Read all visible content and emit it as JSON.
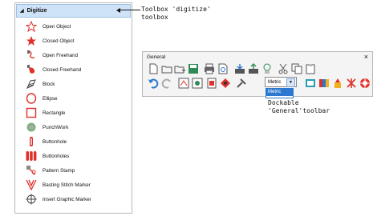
{
  "toolbox": {
    "title": "Digitize",
    "items": [
      {
        "label": "Open Object",
        "icon": "open-object-icon"
      },
      {
        "label": "Closed Object",
        "icon": "closed-object-icon"
      },
      {
        "label": "Open Freehand",
        "icon": "open-freehand-icon"
      },
      {
        "label": "Closed Freehand",
        "icon": "closed-freehand-icon"
      },
      {
        "label": "Block",
        "icon": "block-icon"
      },
      {
        "label": "Ellipse",
        "icon": "ellipse-icon"
      },
      {
        "label": "Rectangle",
        "icon": "rectangle-icon"
      },
      {
        "label": "PunchWork",
        "icon": "punchwork-icon"
      },
      {
        "label": "Buttonhole",
        "icon": "buttonhole-icon"
      },
      {
        "label": "Buttonholes",
        "icon": "buttonholes-icon"
      },
      {
        "label": "Pattern Stamp",
        "icon": "pattern-stamp-icon"
      },
      {
        "label": "Basting Stitch Marker",
        "icon": "basting-stitch-marker-icon"
      },
      {
        "label": "Insert Graphic Marker",
        "icon": "insert-graphic-marker-icon"
      }
    ]
  },
  "callouts": {
    "toolbox_note": "Toolbox 'digitize'\ntoolbox",
    "toolbar_note": "Dockable\n'General'toolbar"
  },
  "general": {
    "title": "General",
    "close": "×",
    "units_value": "Metric",
    "units_option": "Metric"
  },
  "colors": {
    "accent_red": "#e0302a",
    "header_blue": "#cfe3f8",
    "selection_blue": "#2a78d0"
  }
}
